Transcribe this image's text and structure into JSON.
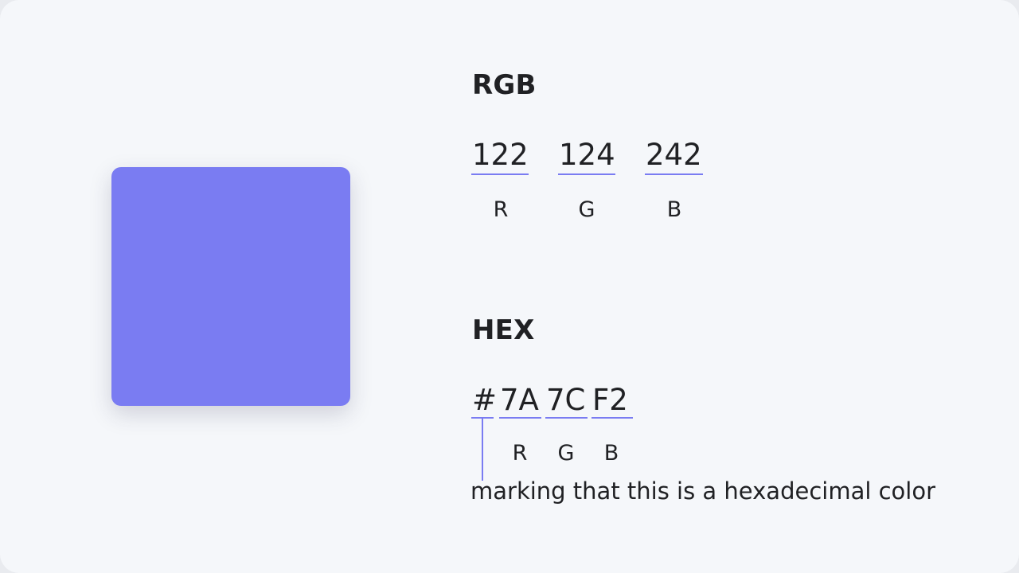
{
  "colors": {
    "swatch": "#7A7CF2",
    "accent": "#7A7CF2",
    "background": "#F5F7FA",
    "text": "#202124"
  },
  "rgb": {
    "heading": "RGB",
    "values": [
      {
        "value": "122",
        "label": "R"
      },
      {
        "value": "124",
        "label": "G"
      },
      {
        "value": "242",
        "label": "B"
      }
    ]
  },
  "hex": {
    "heading": "HEX",
    "prefix": "#",
    "values": [
      {
        "value": "7A",
        "label": "R"
      },
      {
        "value": "7C",
        "label": "G"
      },
      {
        "value": "F2",
        "label": "B"
      }
    ],
    "note": "marking that this is a hexadecimal color"
  }
}
